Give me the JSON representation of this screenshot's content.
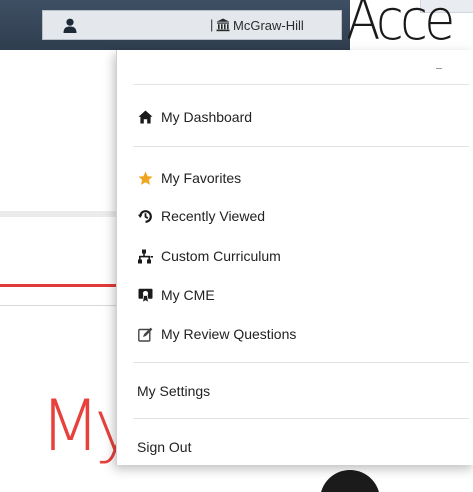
{
  "header": {
    "institution": "McGraw-Hill",
    "separator": "|",
    "logo_text": "Acce"
  },
  "menu": {
    "items": [
      {
        "key": "dashboard",
        "label": "My Dashboard",
        "icon": "home-icon"
      },
      {
        "key": "favorites",
        "label": "My Favorites",
        "icon": "star-icon"
      },
      {
        "key": "recent",
        "label": "Recently Viewed",
        "icon": "history-icon"
      },
      {
        "key": "curriculum",
        "label": "Custom Curriculum",
        "icon": "sitemap-icon"
      },
      {
        "key": "cme",
        "label": "My CME",
        "icon": "certificate-icon"
      },
      {
        "key": "review",
        "label": "My Review Questions",
        "icon": "edit-icon"
      },
      {
        "key": "settings",
        "label": "My Settings",
        "icon": ""
      },
      {
        "key": "signout",
        "label": "Sign Out",
        "icon": ""
      }
    ]
  },
  "background": {
    "partial_heading": "My"
  },
  "colors": {
    "star": "#f0a51e",
    "topbar": "#34445a",
    "accent_red": "#e03b3b"
  }
}
